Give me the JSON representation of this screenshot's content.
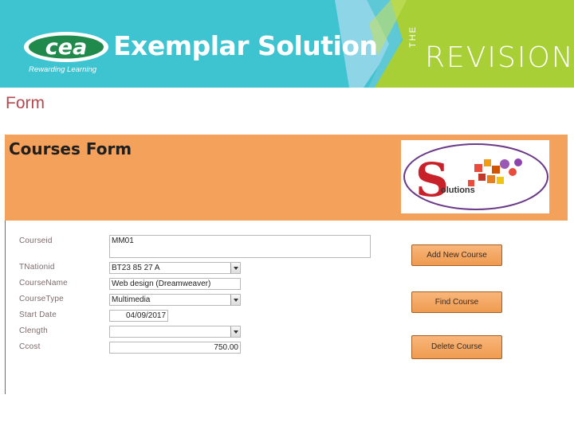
{
  "banner": {
    "cea_logo_text": "cea",
    "cea_tagline": "Rewarding Learning",
    "title": "Exemplar Solution",
    "revision_the": "THE",
    "revision_word": "REVISION",
    "colors": {
      "teal": "#3ec3d0",
      "green": "#a8cf35",
      "light_blue": "#8fd5e8"
    }
  },
  "slide": {
    "label": "Form"
  },
  "form": {
    "title": "Courses Form",
    "logo_initial": "S",
    "logo_text": "olutions",
    "header_color": "#f4a15b",
    "fields": [
      {
        "label": "Courseid",
        "value": "MM01"
      },
      {
        "label": "TNationid",
        "value": "BT23 85 27 A"
      },
      {
        "label": "CourseName",
        "value": "Web design (Dreamweaver)"
      },
      {
        "label": "CourseType",
        "value": "Multimedia"
      },
      {
        "label": "Start Date",
        "value": "04/09/2017"
      },
      {
        "label": "Clength",
        "value": ""
      },
      {
        "label": "Ccost",
        "value": "750.00"
      }
    ],
    "buttons": {
      "add": "Add New Course",
      "find": "Find Course",
      "delete": "Delete Course"
    }
  }
}
